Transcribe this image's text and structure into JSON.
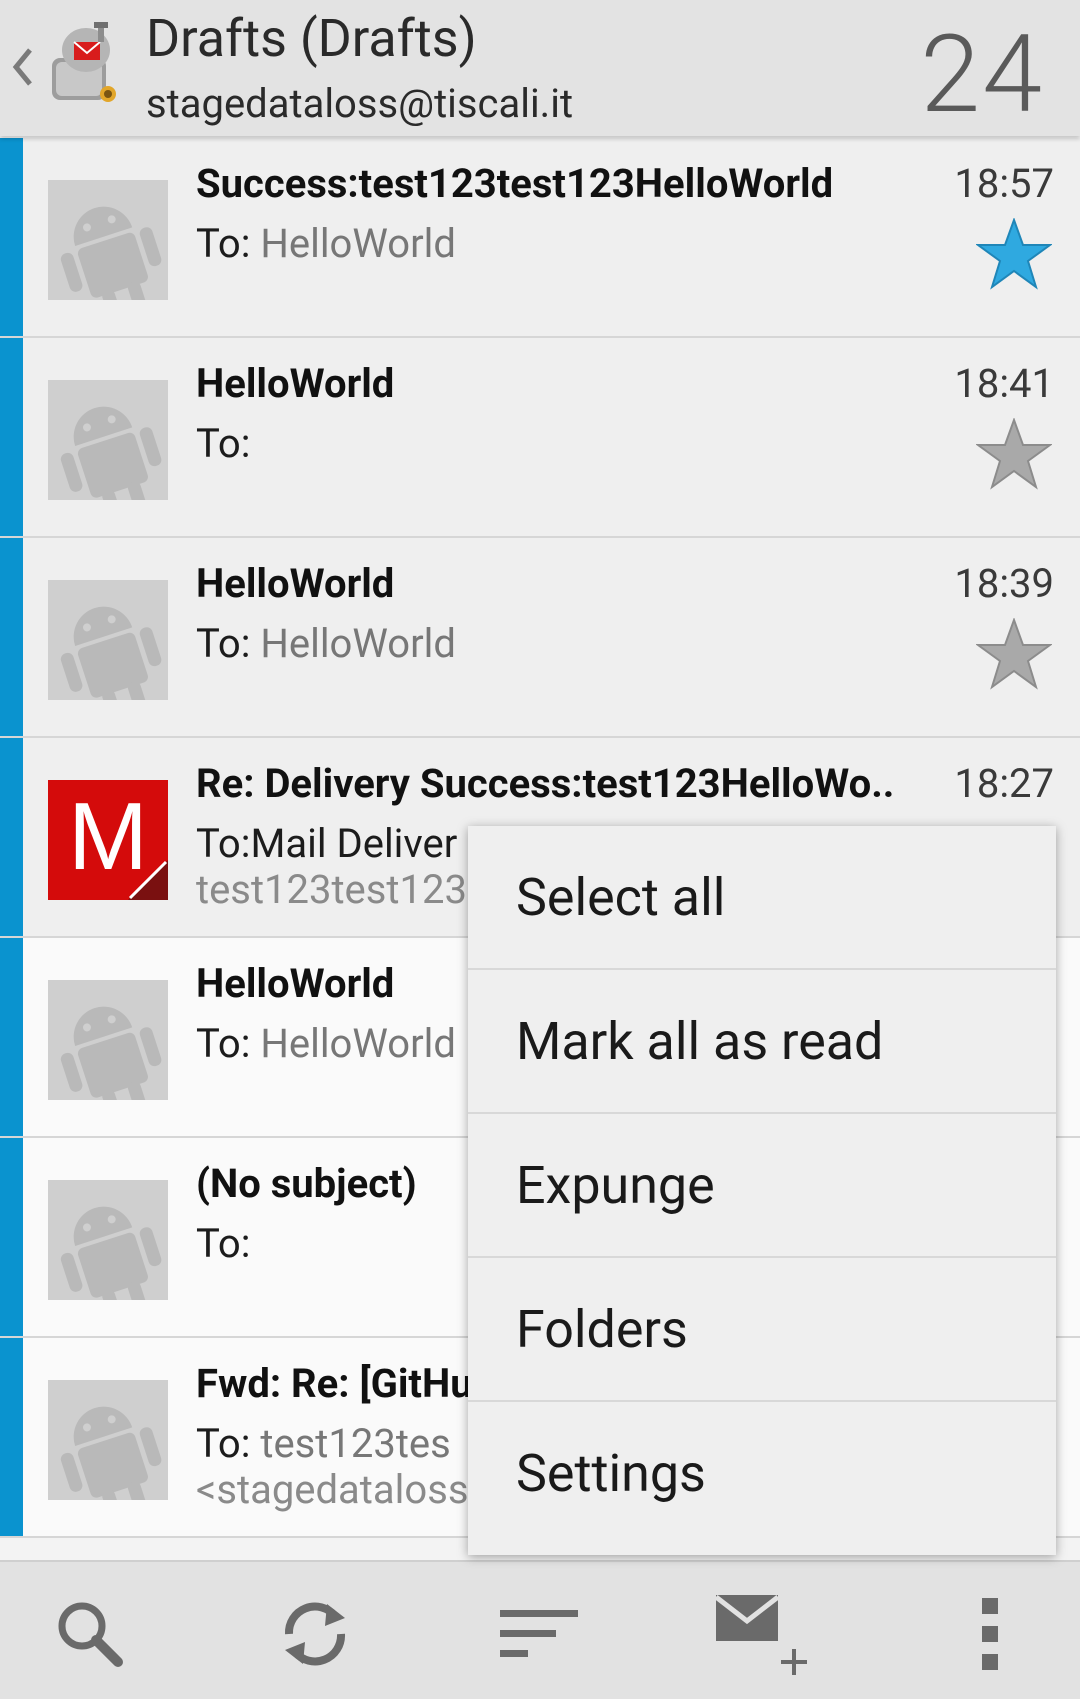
{
  "header": {
    "title": "Drafts (Drafts)",
    "account": "stagedataloss@tiscali.it",
    "count": "24"
  },
  "colors": {
    "accent_bar": "#0a93cf",
    "star_active": "#2fa9e0",
    "star_inactive": "#a9a9a9",
    "avatar_m": "#d40b0b"
  },
  "messages": [
    {
      "subject": "Success:test123test123HelloWorld",
      "to_label": "To: ",
      "recipient": "HelloWorld",
      "preview": "",
      "time": "18:57",
      "starred": true,
      "avatar": "android-placeholder-icon"
    },
    {
      "subject": "HelloWorld",
      "to_label": "To:",
      "recipient": "",
      "preview": "",
      "time": "18:41",
      "starred": false,
      "avatar": "android-placeholder-icon"
    },
    {
      "subject": "HelloWorld",
      "to_label": "To: ",
      "recipient": "HelloWorld",
      "preview": "",
      "time": "18:39",
      "starred": false,
      "avatar": "android-placeholder-icon"
    },
    {
      "subject": "Re: Delivery Success:test123HelloWo..",
      "to_label": "To:",
      "recipient": "Mail Deliver",
      "preview": "test123test123",
      "time": "18:27",
      "starred": false,
      "avatar": "M",
      "avatar_letter": "M"
    },
    {
      "subject": "HelloWorld",
      "to_label": "To: ",
      "recipient": "HelloWorld",
      "preview": "",
      "time": "",
      "starred": false,
      "avatar": "android-placeholder-icon"
    },
    {
      "subject": "(No subject)",
      "to_label": "To:",
      "recipient": "",
      "preview": "",
      "time": "",
      "starred": false,
      "avatar": "android-placeholder-icon"
    },
    {
      "subject": "Fwd: Re: [GitHu",
      "to_label": "To: ",
      "recipient": "test123tes",
      "preview": "<stagedataloss",
      "time": "",
      "starred": false,
      "avatar": "android-placeholder-icon"
    }
  ],
  "menu": {
    "items": [
      "Select all",
      "Mark all as read",
      "Expunge",
      "Folders",
      "Settings"
    ]
  },
  "toolbar": {
    "buttons": [
      "search-icon",
      "refresh-icon",
      "sort-icon",
      "compose-icon",
      "overflow-menu-icon"
    ]
  }
}
